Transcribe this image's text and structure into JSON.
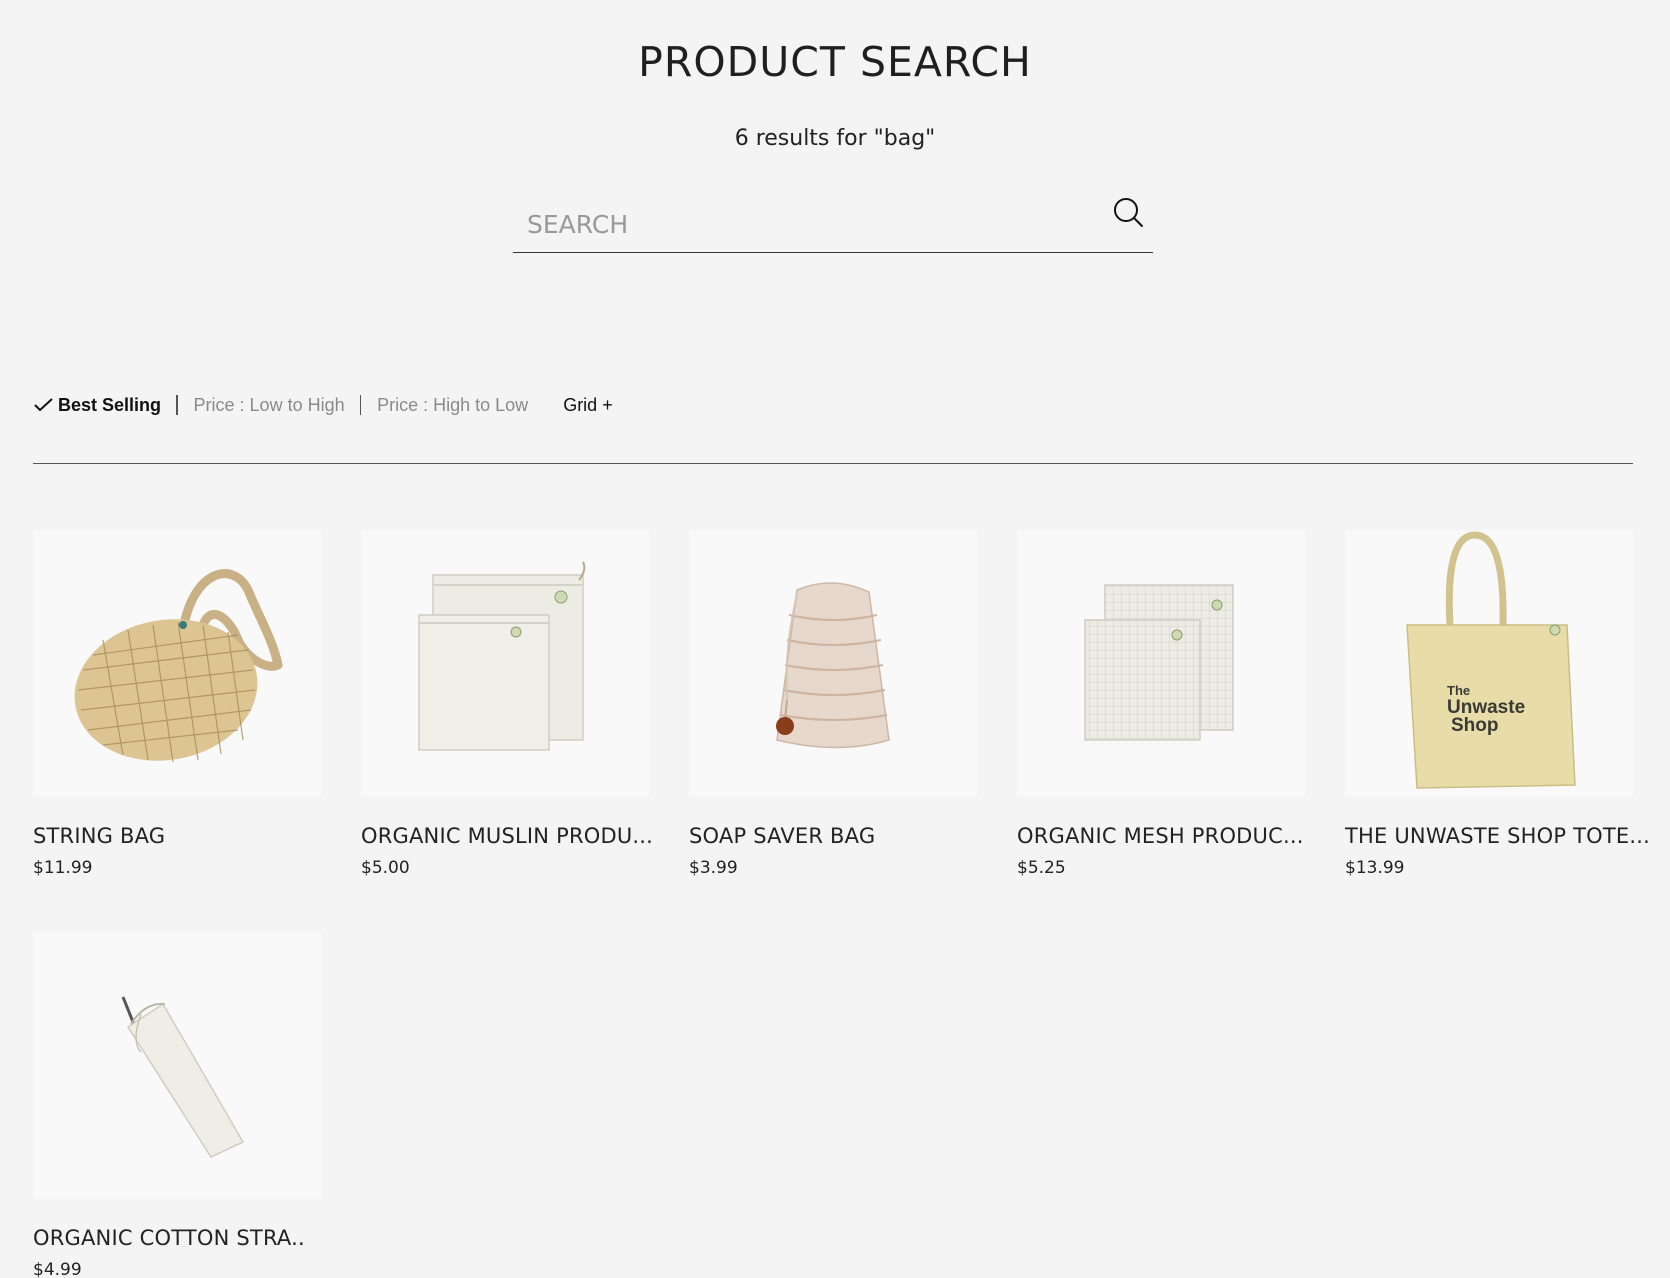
{
  "header": {
    "title": "PRODUCT SEARCH",
    "results_text": "6 results for \"bag\""
  },
  "search": {
    "placeholder": "SEARCH",
    "value": ""
  },
  "sort": {
    "options": [
      {
        "label": "Best Selling",
        "selected": true
      },
      {
        "label": "Price : Low to High",
        "selected": false
      },
      {
        "label": "Price : High to Low",
        "selected": false
      }
    ],
    "grid_label": "Grid +"
  },
  "products": [
    {
      "name": "STRING BAG",
      "price": "$11.99",
      "icon": "string-bag-image"
    },
    {
      "name": "ORGANIC MUSLIN PRODU...",
      "price": "$5.00",
      "icon": "muslin-produce-bag-image"
    },
    {
      "name": "SOAP SAVER BAG",
      "price": "$3.99",
      "icon": "soap-saver-bag-image"
    },
    {
      "name": "ORGANIC MESH PRODUC...",
      "price": "$5.25",
      "icon": "mesh-produce-bag-image"
    },
    {
      "name": "THE UNWASTE SHOP TOTE...",
      "price": "$13.99",
      "icon": "tote-bag-image",
      "logo_text": [
        "The",
        "Unwaste",
        "Shop"
      ]
    },
    {
      "name": "ORGANIC COTTON STRA..",
      "price": "$4.99",
      "icon": "cotton-straw-bag-image"
    }
  ],
  "colors": {
    "background": "#f4f4f4",
    "card_background": "#f9f9f9",
    "text": "#222222",
    "muted": "#8a8a8a"
  }
}
